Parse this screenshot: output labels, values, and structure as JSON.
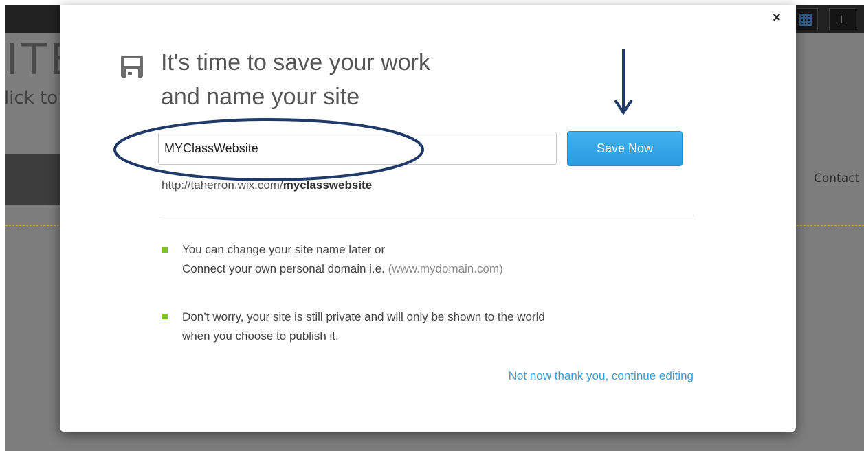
{
  "background": {
    "title_fragment": "ITE",
    "subtitle_fragment": "lick to",
    "nav_item_contact": "Contact",
    "toolbar": {
      "grid_icon": "grid-icon",
      "ruler_icon": "ruler-icon"
    }
  },
  "modal": {
    "close_label": "×",
    "heading_line1": "It's time to save your work",
    "heading_line2": "and name your site",
    "site_name_input": {
      "value": "MYClassWebsite",
      "placeholder": ""
    },
    "save_button_label": "Save Now",
    "url_prefix": "http://taherron.wix.com/",
    "url_slug": "myclasswebsite",
    "info_items": [
      {
        "line1": "You can change your site name later or",
        "line2_text": "Connect your own personal domain i.e. ",
        "line2_muted": "(www.mydomain.com)"
      },
      {
        "line1": "Don’t worry, your site is still private and will only be shown to the world",
        "line2_text": "when you choose to publish it.",
        "line2_muted": ""
      }
    ],
    "not_now_link": "Not now thank you, continue editing"
  },
  "colors": {
    "accent_blue": "#2a9be0",
    "link_blue": "#3b9bd8",
    "bullet_green": "#7fc225",
    "annotation_navy": "#1f3a68"
  }
}
